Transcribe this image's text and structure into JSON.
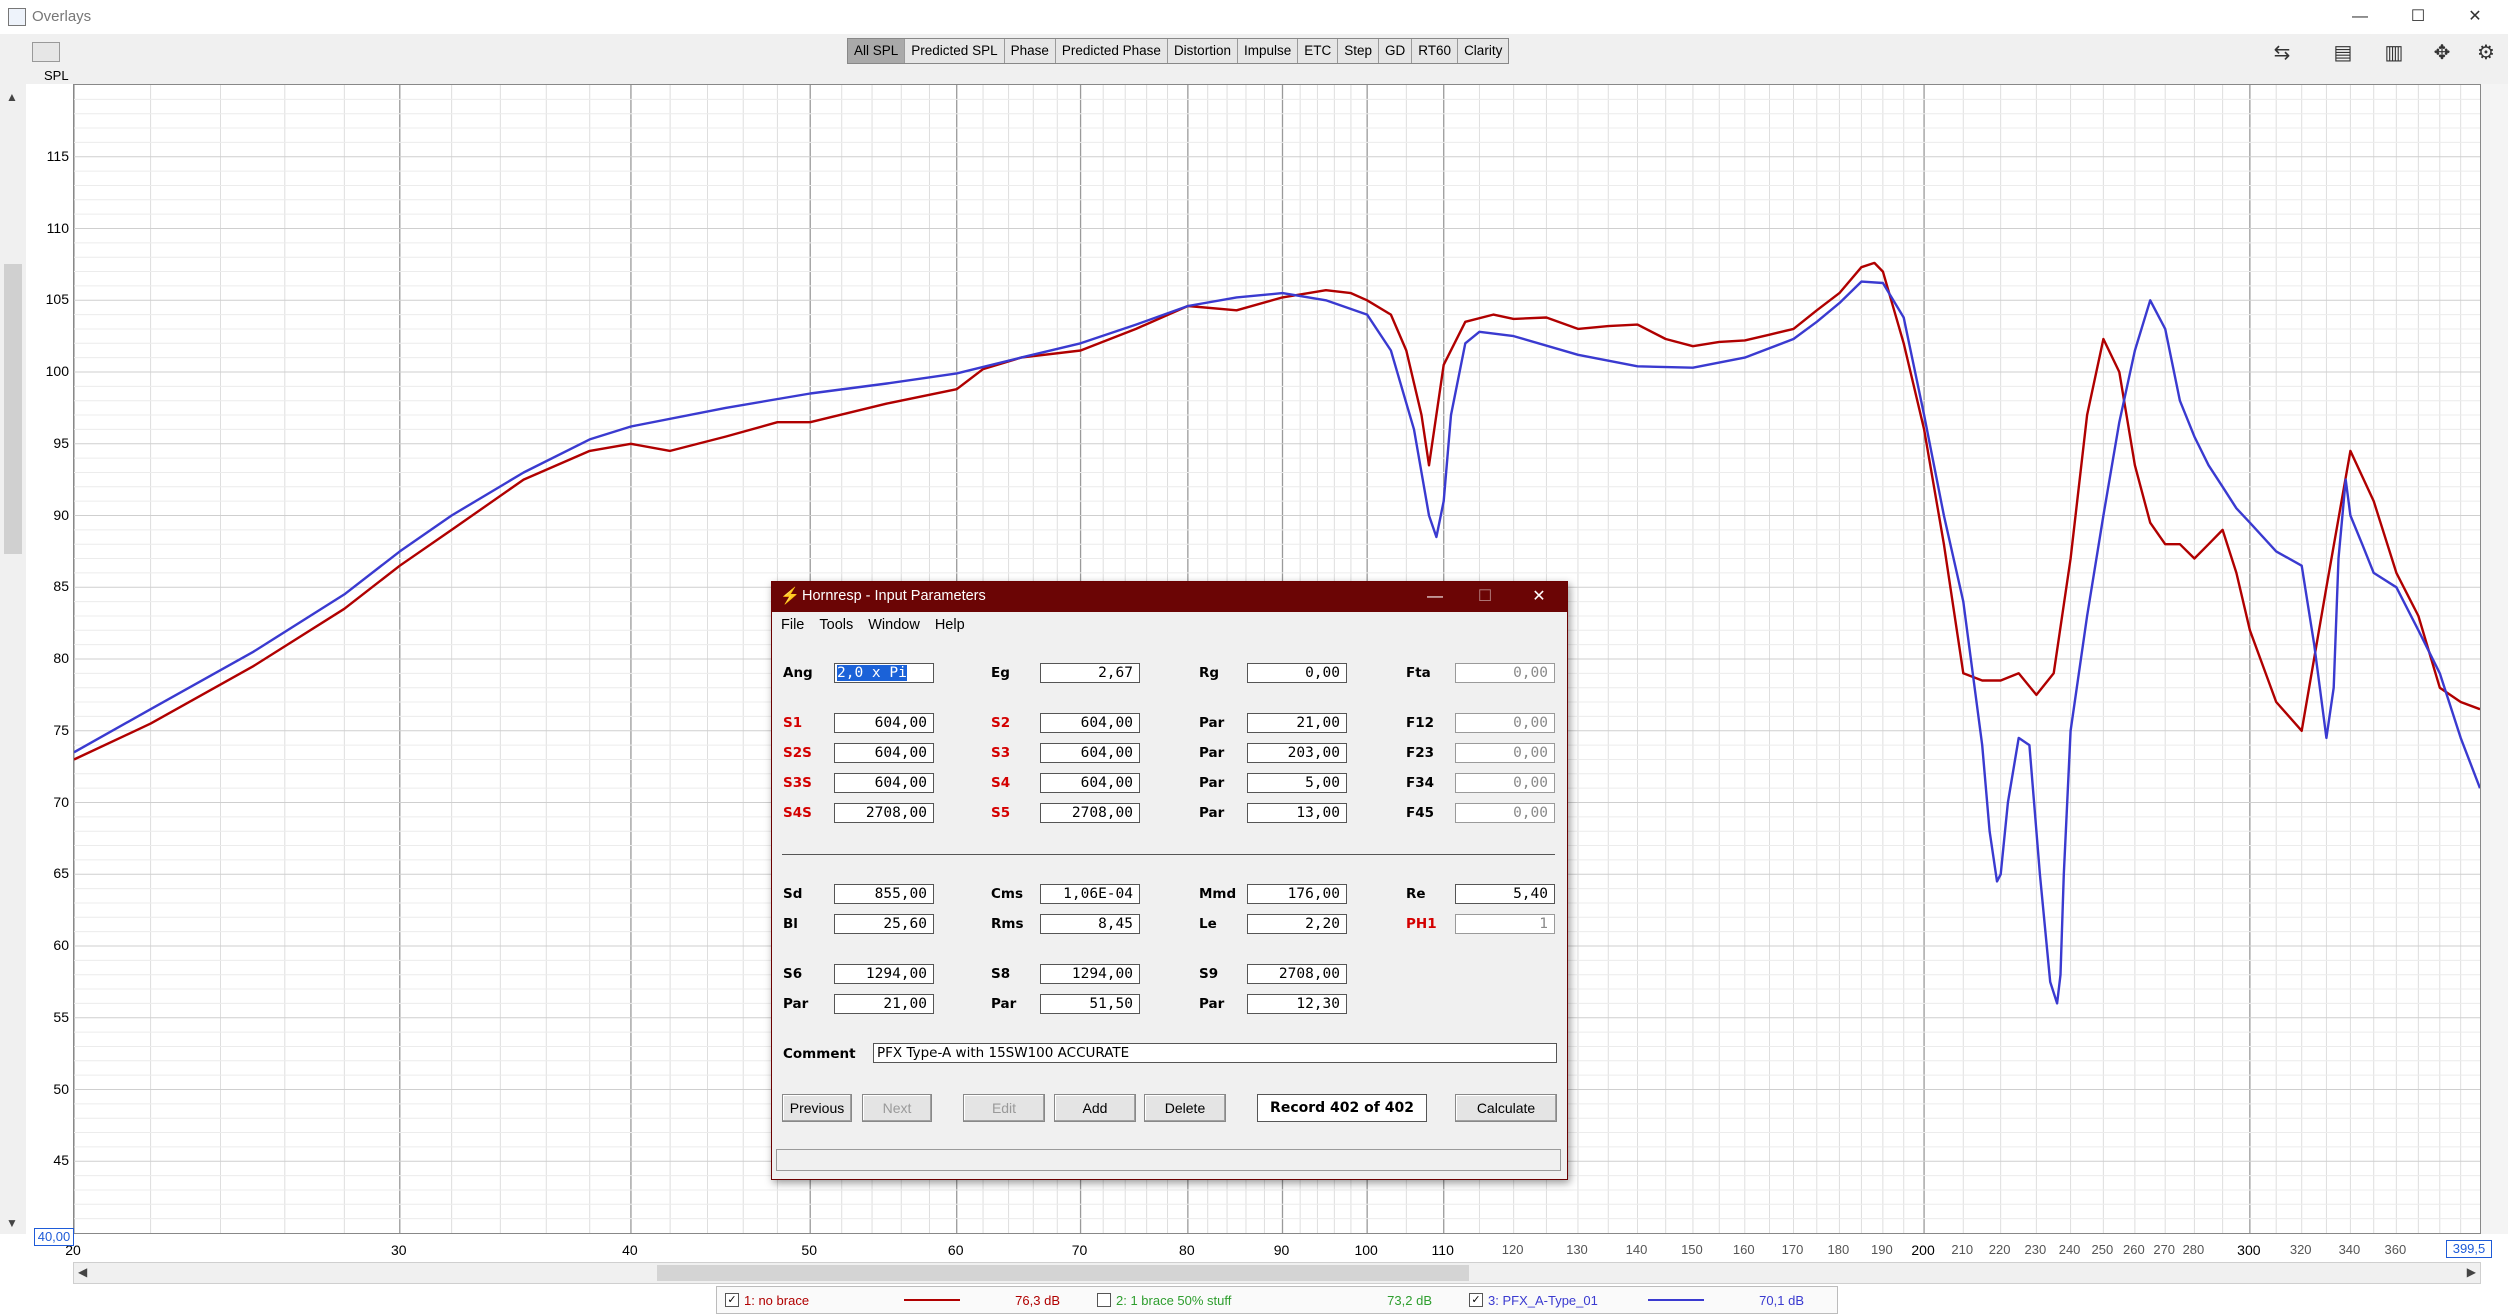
{
  "window": {
    "title": "Overlays",
    "controls": [
      "—",
      "☐",
      "✕"
    ]
  },
  "toolbar": {
    "spl_label": "SPL",
    "tabs": [
      "All SPL",
      "Predicted SPL",
      "Phase",
      "Predicted Phase",
      "Distortion",
      "Impulse",
      "ETC",
      "Step",
      "GD",
      "RT60",
      "Clarity"
    ],
    "active_tab": "All SPL",
    "right_icons": [
      "overlay-compare-icon",
      "capture-icon",
      "layout-icon",
      "pan-icon",
      "settings-icon"
    ]
  },
  "plot": {
    "y_box": "40,00",
    "x_box": "399,5",
    "y_ticks": [
      "115",
      "110",
      "105",
      "100",
      "95",
      "90",
      "85",
      "80",
      "75",
      "70",
      "65",
      "60",
      "55",
      "50",
      "45"
    ],
    "x_ticks": [
      "20",
      "30",
      "40",
      "50",
      "60",
      "70",
      "80",
      "90",
      "100",
      "110",
      "120",
      "130",
      "140",
      "150",
      "160",
      "170",
      "180",
      "190",
      "200",
      "210",
      "220",
      "230",
      "240",
      "250",
      "260",
      "270",
      "280",
      "300",
      "320",
      "340",
      "360"
    ],
    "major_x": [
      "20",
      "30",
      "40",
      "50",
      "60",
      "70",
      "80",
      "90",
      "100",
      "110",
      "200",
      "300"
    ]
  },
  "chart_data": {
    "type": "line",
    "xlabel": "",
    "ylabel": "SPL",
    "xscale": "log",
    "xlim": [
      20,
      399.5
    ],
    "ylim": [
      40,
      120
    ],
    "grid": true,
    "series": [
      {
        "name": "1: no brace",
        "color": "#b00000",
        "x": [
          20,
          22,
          25,
          28,
          30,
          32,
          35,
          38,
          40,
          42,
          45,
          48,
          50,
          55,
          60,
          62,
          65,
          70,
          75,
          80,
          85,
          90,
          95,
          98,
          100,
          103,
          105,
          107,
          108,
          110,
          113,
          117,
          120,
          125,
          130,
          135,
          140,
          145,
          150,
          155,
          160,
          165,
          170,
          175,
          180,
          185,
          188,
          190,
          195,
          200,
          205,
          210,
          215,
          220,
          225,
          230,
          235,
          240,
          245,
          250,
          255,
          260,
          265,
          270,
          275,
          280,
          285,
          290,
          295,
          300,
          310,
          320,
          330,
          340,
          350,
          360,
          370,
          380,
          390,
          399.5
        ],
        "y": [
          73,
          75.5,
          79.5,
          83.5,
          86.5,
          89,
          92.5,
          94.5,
          95,
          94.5,
          95.5,
          96.5,
          96.5,
          97.8,
          98.8,
          100.2,
          101,
          101.5,
          103,
          104.6,
          104.3,
          105.2,
          105.7,
          105.5,
          105,
          104,
          101.5,
          97,
          93.5,
          100.5,
          103.5,
          104,
          103.7,
          103.8,
          103,
          103.2,
          103.3,
          102.3,
          101.8,
          102.1,
          102.2,
          102.6,
          103,
          104.3,
          105.5,
          107.3,
          107.6,
          107,
          102,
          96,
          88,
          79,
          78.5,
          78.5,
          79,
          77.5,
          79,
          87,
          97,
          102.3,
          100,
          93.5,
          89.5,
          88,
          88,
          87,
          88,
          89,
          86,
          82,
          77,
          75,
          85,
          94.5,
          91,
          86,
          83,
          78,
          77,
          76.5
        ]
      },
      {
        "name": "2: 1 brace 50% stuff",
        "color": "#2e9e2e",
        "y": [],
        "hidden": true
      },
      {
        "name": "3: PFX_A-Type_01",
        "color": "#3a3ad0",
        "x": [
          20,
          22,
          25,
          28,
          30,
          32,
          35,
          38,
          40,
          45,
          50,
          55,
          60,
          65,
          70,
          75,
          80,
          85,
          90,
          95,
          100,
          103,
          106,
          108,
          109,
          110,
          111,
          113,
          115,
          120,
          130,
          140,
          150,
          160,
          170,
          175,
          180,
          185,
          190,
          195,
          200,
          205,
          210,
          215,
          217,
          219,
          220,
          222,
          225,
          228,
          231,
          234,
          236,
          237,
          238,
          240,
          245,
          250,
          255,
          260,
          265,
          270,
          275,
          280,
          285,
          290,
          295,
          300,
          310,
          320,
          325,
          330,
          333,
          335,
          338,
          340,
          345,
          350,
          360,
          370,
          380,
          390,
          399.5
        ],
        "y": [
          73.5,
          76.5,
          80.5,
          84.5,
          87.5,
          90,
          93,
          95.3,
          96.2,
          97.5,
          98.5,
          99.2,
          99.9,
          101,
          102,
          103.3,
          104.6,
          105.2,
          105.5,
          105,
          104,
          101.5,
          96,
          90,
          88.5,
          91,
          97,
          102,
          102.8,
          102.5,
          101.2,
          100.4,
          100.3,
          101,
          102.3,
          103.5,
          104.8,
          106.3,
          106.2,
          103.8,
          97,
          90,
          84,
          74,
          68,
          64.5,
          65,
          70,
          74.5,
          74,
          65,
          57.5,
          56,
          58,
          65,
          75,
          83,
          90,
          96.5,
          101.5,
          105,
          103,
          98,
          95.5,
          93.5,
          92,
          90.5,
          89.5,
          87.5,
          86.5,
          81,
          74.5,
          78,
          87,
          92.5,
          90,
          88,
          86,
          85,
          82,
          79,
          74.5,
          71
        ]
      }
    ]
  },
  "legend": [
    {
      "checked": true,
      "label": "1: no brace",
      "value": "76,3 dB",
      "color": "#b00000"
    },
    {
      "checked": false,
      "label": "2: 1 brace 50% stuff",
      "value": "73,2 dB",
      "color": "#2e9e2e"
    },
    {
      "checked": true,
      "label": "3: PFX_A-Type_01",
      "value": "70,1 dB",
      "color": "#3a3ad0"
    }
  ],
  "dialog": {
    "title": "Hornresp - Input Parameters",
    "controls": [
      "—",
      "☐",
      "✕"
    ],
    "menu": [
      "File",
      "Tools",
      "Window",
      "Help"
    ],
    "params": {
      "ang": {
        "label": "Ang",
        "value": "2,0 x Pi"
      },
      "eg": {
        "label": "Eg",
        "value": "2,67"
      },
      "rg": {
        "label": "Rg",
        "value": "0,00"
      },
      "fta": {
        "label": "Fta",
        "value": "0,00"
      },
      "s1": {
        "label": "S1",
        "value": "604,00"
      },
      "s2": {
        "label": "S2",
        "value": "604,00"
      },
      "par1": {
        "label": "Par",
        "value": "21,00"
      },
      "f12": {
        "label": "F12",
        "value": "0,00"
      },
      "s2s": {
        "label": "S2S",
        "value": "604,00"
      },
      "s3": {
        "label": "S3",
        "value": "604,00"
      },
      "par2": {
        "label": "Par",
        "value": "203,00"
      },
      "f23": {
        "label": "F23",
        "value": "0,00"
      },
      "s3s": {
        "label": "S3S",
        "value": "604,00"
      },
      "s4": {
        "label": "S4",
        "value": "604,00"
      },
      "par3": {
        "label": "Par",
        "value": "5,00"
      },
      "f34": {
        "label": "F34",
        "value": "0,00"
      },
      "s4s": {
        "label": "S4S",
        "value": "2708,00"
      },
      "s5": {
        "label": "S5",
        "value": "2708,00"
      },
      "par4": {
        "label": "Par",
        "value": "13,00"
      },
      "f45": {
        "label": "F45",
        "value": "0,00"
      },
      "sd": {
        "label": "Sd",
        "value": "855,00"
      },
      "cms": {
        "label": "Cms",
        "value": "1,06E-04"
      },
      "mmd": {
        "label": "Mmd",
        "value": "176,00"
      },
      "re": {
        "label": "Re",
        "value": "5,40"
      },
      "bl": {
        "label": "Bl",
        "value": "25,60"
      },
      "rms": {
        "label": "Rms",
        "value": "8,45"
      },
      "le": {
        "label": "Le",
        "value": "2,20"
      },
      "ph1": {
        "label": "PH1",
        "value": "1"
      },
      "s6": {
        "label": "S6",
        "value": "1294,00"
      },
      "s8": {
        "label": "S8",
        "value": "1294,00"
      },
      "s9": {
        "label": "S9",
        "value": "2708,00"
      },
      "par6": {
        "label": "Par",
        "value": "21,00"
      },
      "par8": {
        "label": "Par",
        "value": "51,50"
      },
      "par9": {
        "label": "Par",
        "value": "12,30"
      }
    },
    "comment_label": "Comment",
    "comment": "PFX Type-A  with 15SW100 ACCURATE",
    "buttons": {
      "previous": "Previous",
      "next": "Next",
      "edit": "Edit",
      "add": "Add",
      "delete": "Delete",
      "calculate": "Calculate"
    },
    "record": "Record 402 of 402"
  }
}
